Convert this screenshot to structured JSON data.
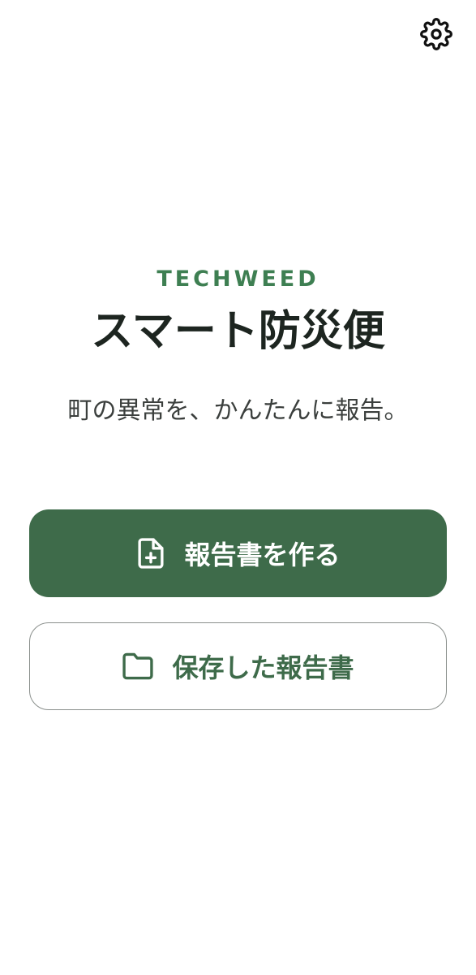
{
  "header": {
    "settings_icon": "gear-icon"
  },
  "hero": {
    "brand": "TECHWEED",
    "title": "スマート防災便",
    "tagline": "町の異常を、かんたんに報告。"
  },
  "actions": {
    "create_report": {
      "label": "報告書を作る",
      "icon": "file-plus-icon"
    },
    "saved_reports": {
      "label": "保存した報告書",
      "icon": "folder-icon"
    }
  },
  "colors": {
    "brand_green": "#3e7f52",
    "primary_button": "#3e6b4a",
    "title_text": "#1d2520"
  }
}
